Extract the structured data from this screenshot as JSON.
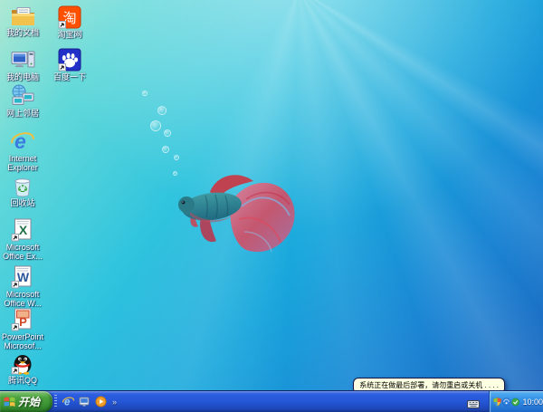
{
  "desktop": {
    "icons": [
      {
        "label": "我的文档"
      },
      {
        "label": "淘宝网"
      },
      {
        "label": "我的电脑"
      },
      {
        "label": "百度一下"
      },
      {
        "label": "网上邻居"
      },
      {
        "label": "Internet\nExplorer"
      },
      {
        "label": "回收站"
      },
      {
        "label": "Microsoft\nOffice Ex..."
      },
      {
        "label": "Microsoft\nOffice W..."
      },
      {
        "label": "PowerPoint\nMicrosof..."
      },
      {
        "label": "腾讯QQ"
      }
    ],
    "icon_glyphs": {
      "taobao": "淘",
      "ie": "e",
      "excel": "X",
      "word": "W",
      "powerpoint": "P"
    }
  },
  "taskbar": {
    "start_label": "开始",
    "quicklaunch_overflow": "»",
    "clock": "10:00"
  },
  "balloon": {
    "text": "系统正在做最后部署，请勿重启或关机 . . . ."
  },
  "colors": {
    "wallpaper_top_left": "#aee9d3",
    "wallpaper_center": "#30c4de",
    "wallpaper_bottom_right": "#1a63bd",
    "taskbar_blue": "#2456d6",
    "start_button_green": "#3d9435",
    "tray_light_blue": "#3490e6",
    "balloon_bg": "#ffffe1",
    "balloon_border": "#16164a",
    "taobao_orange": "#ff5000",
    "icon_label_color": "#ffffff"
  }
}
